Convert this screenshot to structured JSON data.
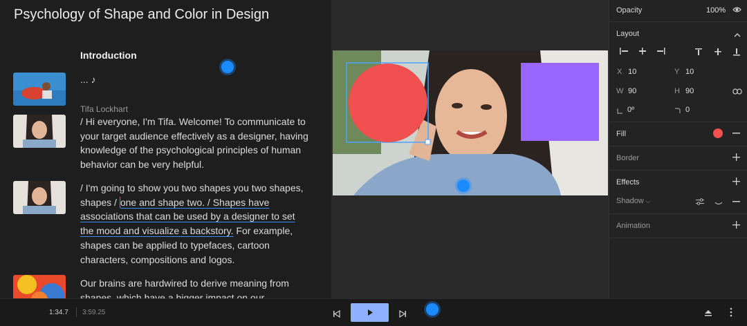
{
  "document": {
    "title": "Psychology of Shape and Color in Design",
    "section_heading": "Introduction",
    "ellipsis_line": "... ♪",
    "speaker": "Tifa Lockhart",
    "para1": "/ Hi everyone, I'm Tifa. Welcome! To communicate to your target audience effectively as a designer, having knowledge of the psychological principles of human behavior can be very helpful.",
    "para2_a": "/ I'm going to show you two shapes you two shapes, shapes /",
    "para2_b": "one and shape two. / Shapes have associations that can be used by a designer to set the mood and visualize a backstory.",
    "para2_c": " For example, shapes can be applied to typefaces, cartoon characters, compositions and logos.",
    "para3": "Our brains are hardwired to derive meaning from shapes, which have a bigger impact on our"
  },
  "properties": {
    "opacity_label": "Opacity",
    "opacity_value": "100%",
    "layout_label": "Layout",
    "x_label": "X",
    "x_value": "10",
    "y_label": "Y",
    "y_value": "10",
    "w_label": "W",
    "w_value": "90",
    "h_label": "H",
    "h_value": "90",
    "rotation_value": "0º",
    "radius_value": "0",
    "fill_label": "Fill",
    "fill_color": "#f05050",
    "border_label": "Border",
    "effects_label": "Effects",
    "shadow_label": "Shadow",
    "animation_label": "Animation"
  },
  "playback": {
    "current_time": "1:34.7",
    "total_time": "3:59.25"
  },
  "colors": {
    "accent": "#1a8cff",
    "circle": "#f05050",
    "square": "#9966ff",
    "play_button": "#8fb0ff"
  }
}
